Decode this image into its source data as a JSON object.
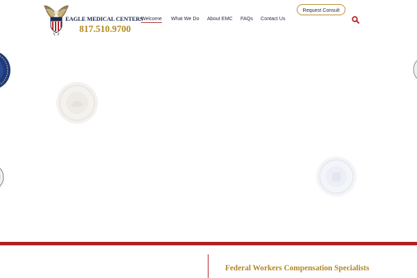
{
  "brand": {
    "name": "EAGLE MEDICAL CENTERS",
    "phone": "817.510.9700",
    "logo_icon": "eagle-shield-icon",
    "colors": {
      "navy": "#1d2a4e",
      "gold": "#b58a20",
      "red": "#b02126"
    }
  },
  "nav": {
    "items": [
      {
        "label": "Welcome",
        "active": true
      },
      {
        "label": "What We Do",
        "active": false
      },
      {
        "label": "About EMC",
        "active": false
      },
      {
        "label": "FAQs",
        "active": false
      },
      {
        "label": "Contact Us",
        "active": false
      }
    ]
  },
  "header": {
    "cta_label": "Request Consult",
    "search_icon": "search-icon"
  },
  "content": {
    "tagline": "Federal Workers Compensation Specialists"
  }
}
